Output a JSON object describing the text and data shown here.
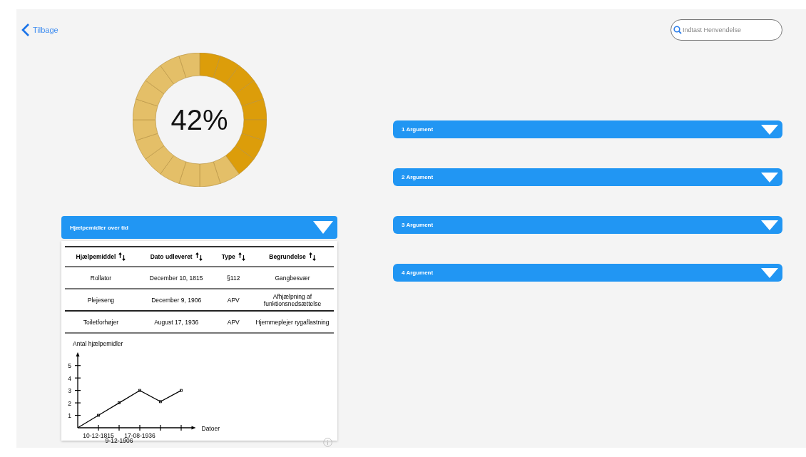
{
  "back_link": {
    "label": "Tilbage"
  },
  "search": {
    "placeholder": "Indtast Henvendelse"
  },
  "progress": {
    "level": 0.42,
    "reading": "42%"
  },
  "panel": {
    "title": "Hjælpemidler over tid",
    "table": {
      "columns": [
        "Hjælpemiddel",
        "Dato udleveret",
        "Type",
        "Begrundelse"
      ],
      "rows": [
        [
          "Rollator",
          "December 10, 1815",
          "§112",
          "Gangbesvær"
        ],
        [
          "Plejeseng",
          "December 9, 1906",
          "APV",
          "Afhjælpning af funktionsnedsættelse"
        ],
        [
          "Toiletforhøjer",
          "August 17, 1936",
          "APV",
          "Hjemmeplejer rygaflastning"
        ]
      ]
    },
    "chart_data": {
      "type": "line",
      "xlabel": "Datoer",
      "ylabel": "Antal hjælpemidler",
      "categories": [
        null,
        "10-12-1815",
        "9-12-1906",
        "17-08-1936",
        null,
        null
      ],
      "values": [
        0,
        1,
        2,
        3,
        2.1,
        3
      ],
      "marker": "square",
      "yticks": [
        1,
        2,
        3,
        4,
        5
      ],
      "ylim": [
        0,
        5.9
      ]
    }
  },
  "arguments": [
    {
      "title": "1 Argument"
    },
    {
      "title": "2 Argument"
    },
    {
      "title": "3 Argument"
    },
    {
      "title": "4 Argument"
    }
  ]
}
